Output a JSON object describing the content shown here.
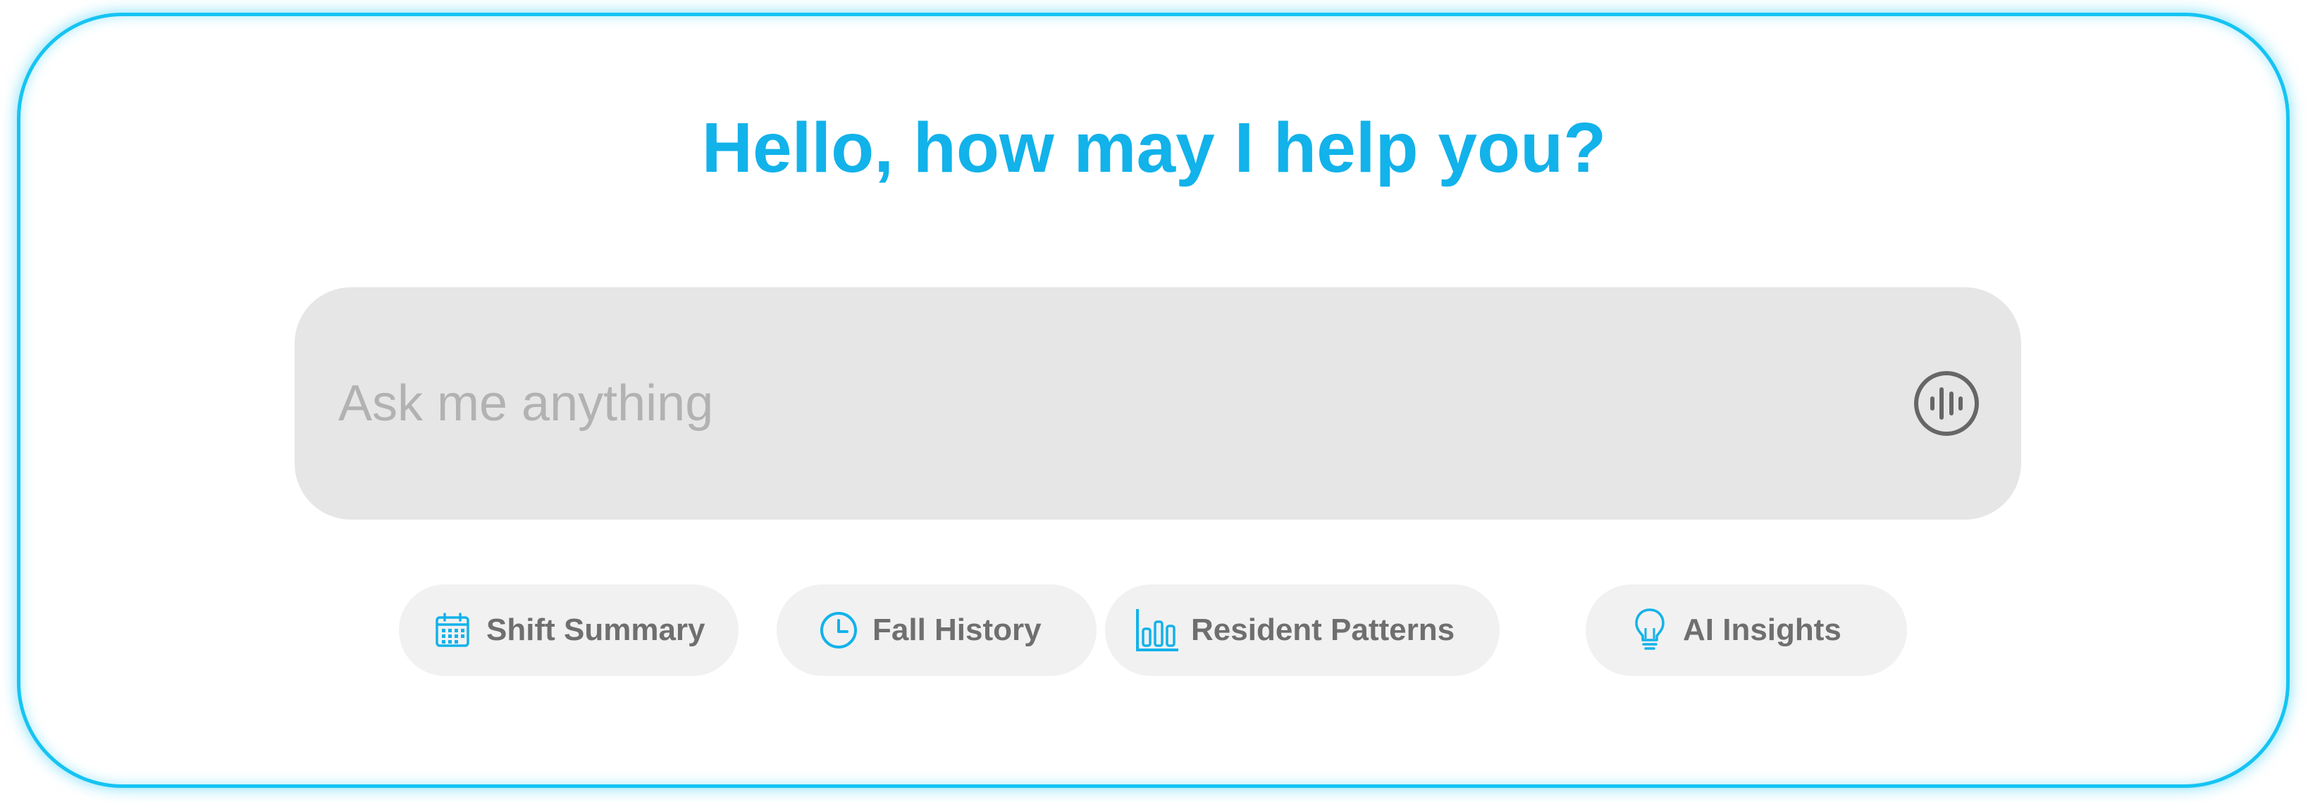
{
  "greeting": "Hello, how may I help you?",
  "search": {
    "placeholder": "Ask me anything",
    "value": "",
    "voice_icon": "voice-waveform-icon"
  },
  "quick_actions": [
    {
      "label": "Shift Summary",
      "icon": "calendar-icon"
    },
    {
      "label": "Fall History",
      "icon": "clock-icon"
    },
    {
      "label": "Resident Patterns",
      "icon": "bar-chart-icon"
    },
    {
      "label": "AI Insights",
      "icon": "lightbulb-icon"
    }
  ],
  "colors": {
    "accent": "#12b2ea",
    "frame_border": "#15c4f2",
    "search_background": "#e6e6e6",
    "chip_background": "#f1f1f1",
    "chip_text": "#6f6f6f",
    "placeholder_text": "#b2b2b2",
    "icon_dark": "#666666"
  }
}
